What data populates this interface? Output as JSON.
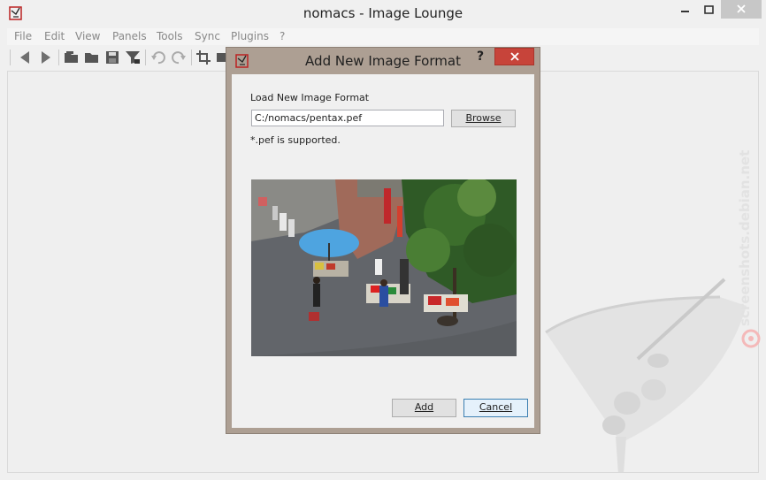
{
  "window": {
    "title": "nomacs - Image Lounge"
  },
  "menu": {
    "items": [
      "File",
      "Edit",
      "View",
      "Panels",
      "Tools",
      "Sync",
      "Plugins",
      "?"
    ]
  },
  "toolbar": {
    "icons": [
      "arrow-left-icon",
      "arrow-right-icon",
      "open-folder-icon",
      "folder-icon",
      "save-icon",
      "filter-icon",
      "rotate-left-icon",
      "rotate-right-icon",
      "crop-icon",
      "resize-icon"
    ]
  },
  "dialog": {
    "title": "Add New Image Format",
    "help": "?",
    "load_label": "Load New Image Format",
    "path_value": "C:/nomacs/pentax.pef",
    "browse_label": "Browse",
    "supported_text": "*.pef is supported.",
    "add_label": "Add",
    "cancel_label": "Cancel"
  },
  "watermark": {
    "text": "screenshots.debian.net"
  },
  "colors": {
    "dialog_frame": "#ad9f93",
    "close_button": "#c7443a",
    "window_bg": "#f0f0f0"
  }
}
